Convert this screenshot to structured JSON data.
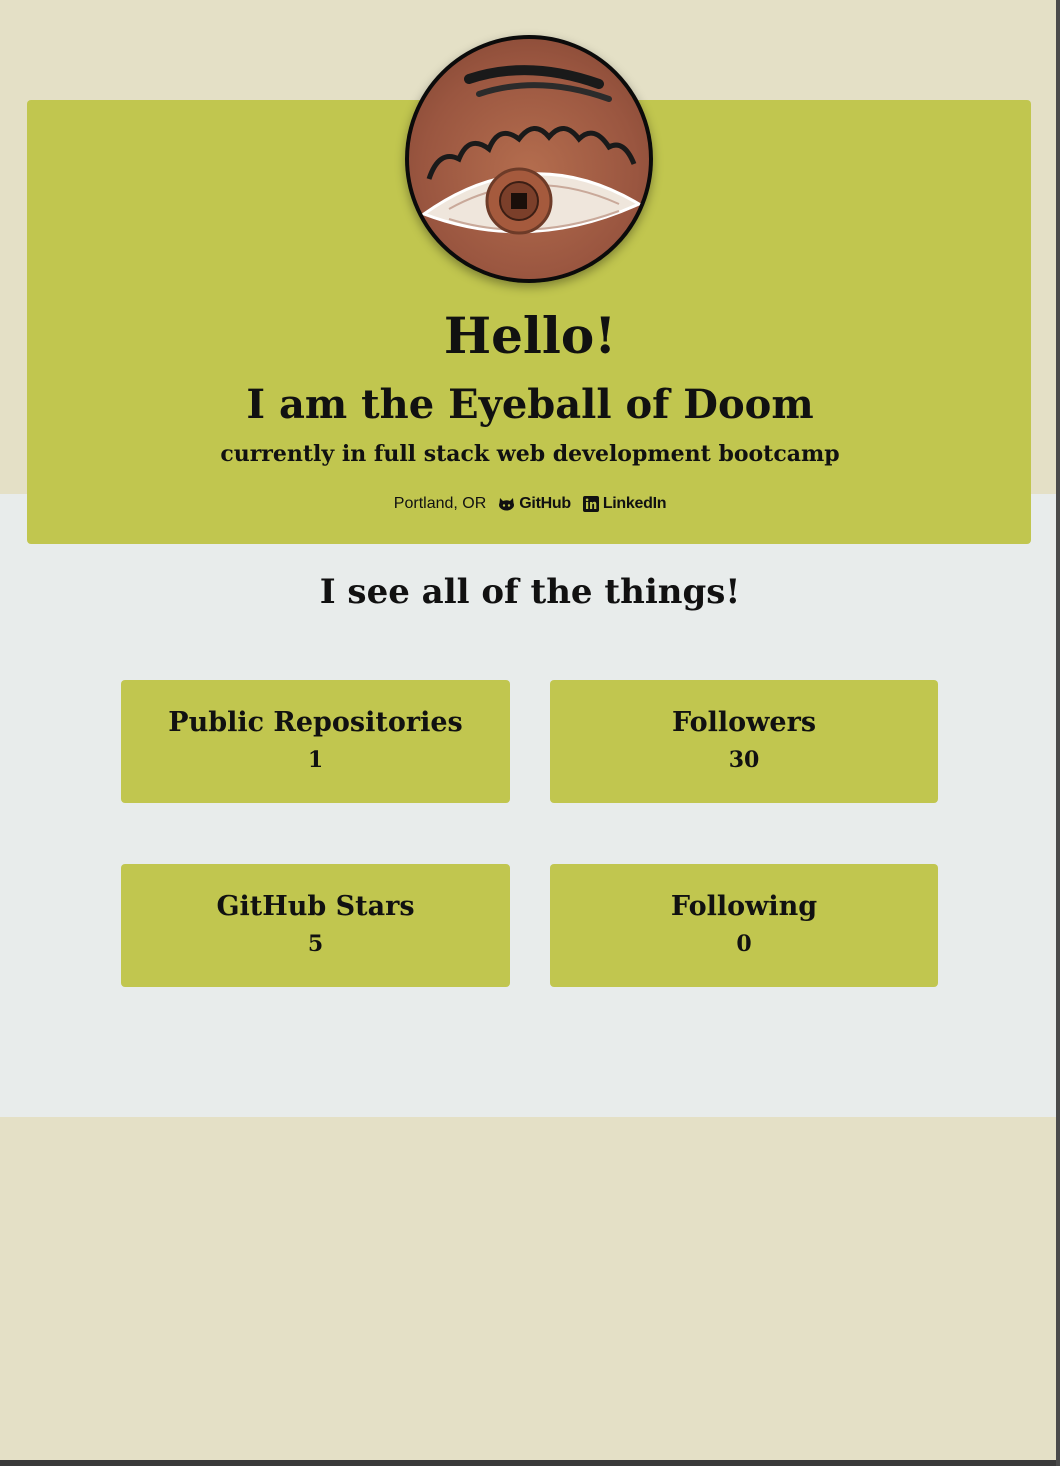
{
  "profile": {
    "greeting": "Hello!",
    "name_line": "I am the Eyeball of Doom",
    "tagline": "currently in full stack web development bootcamp",
    "location": "Portland, OR",
    "links": {
      "github": "GitHub",
      "linkedin": "LinkedIn"
    },
    "avatar_icon": "eyeball-drawing"
  },
  "main": {
    "heading": "I see all of the things!"
  },
  "stats": [
    {
      "label": "Public Repositories",
      "value": "1"
    },
    {
      "label": "Followers",
      "value": "30"
    },
    {
      "label": "GitHub Stars",
      "value": "5"
    },
    {
      "label": "Following",
      "value": "0"
    }
  ],
  "colors": {
    "accent": "#c1c64f",
    "page_background": "#e4e0c6",
    "content_background": "#e8eceb",
    "text": "#111111"
  }
}
